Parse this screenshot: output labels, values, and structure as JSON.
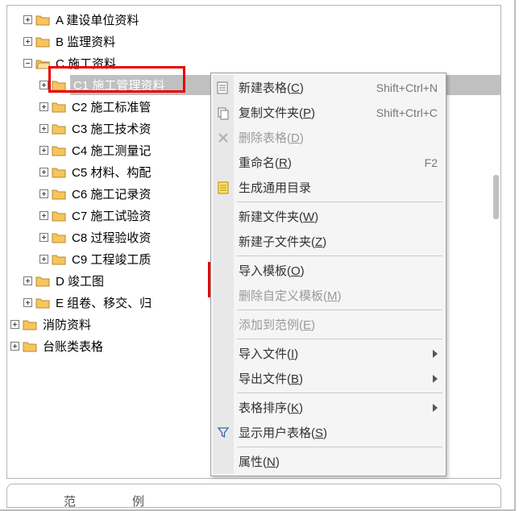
{
  "tree": {
    "root1": "A  建设单位资料",
    "root2": "B  监理资料",
    "root3": "C  施工资料",
    "c1": "C1  施工管理资料",
    "c2": "C2  施工标准管",
    "c3": "C3  施工技术资",
    "c4": "C4  施工测量记",
    "c5": "C5  材料、构配",
    "c6": "C6  施工记录资",
    "c7": "C7  施工试验资",
    "c8": "C8  过程验收资",
    "c9": "C9  工程竣工质",
    "root4": "D  竣工图",
    "root5": "E  组卷、移交、归",
    "root6": "消防资料",
    "root7": "台账类表格"
  },
  "menu": {
    "new_table": "新建表格(C)",
    "new_table_sc": "Shift+Ctrl+N",
    "copy_folder": "复制文件夹(P)",
    "copy_folder_sc": "Shift+Ctrl+C",
    "delete_table": "删除表格(D)",
    "rename": "重命名(R)",
    "rename_sc": "F2",
    "gen_toc": "生成通用目录",
    "new_folder": "新建文件夹(W)",
    "new_subfolder": "新建子文件夹(Z)",
    "import_tpl": "导入模板(O)",
    "del_custom_tpl": "删除自定义模板(M)",
    "add_to_example": "添加到范例(E)",
    "import_file": "导入文件(I)",
    "export_file": "导出文件(B)",
    "table_sort": "表格排序(K)",
    "show_user_tables": "显示用户表格(S)",
    "properties": "属性(N)"
  },
  "bottom": {
    "tab1": "范",
    "tab2": "例"
  }
}
